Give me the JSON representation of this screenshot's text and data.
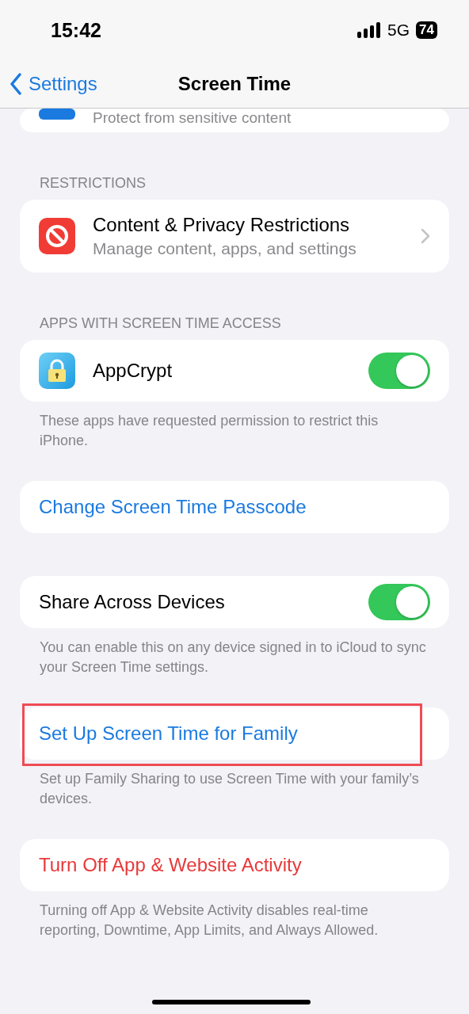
{
  "status_bar": {
    "time": "15:42",
    "network": "5G",
    "battery": "74"
  },
  "nav": {
    "back": "Settings",
    "title": "Screen Time"
  },
  "sections": [
    {
      "rows": [
        {
          "kind": "cut",
          "subtitle": "Protect from sensitive content"
        }
      ]
    },
    {
      "header": "RESTRICTIONS",
      "rows": [
        {
          "kind": "restriction",
          "title": "Content & Privacy Restrictions",
          "subtitle": "Manage content, apps, and settings"
        }
      ]
    },
    {
      "header": "APPS WITH SCREEN TIME ACCESS",
      "rows": [
        {
          "kind": "app",
          "title": "AppCrypt",
          "on": true
        }
      ],
      "footer": "These apps have requested permission to restrict this iPhone."
    },
    {
      "rows": [
        {
          "kind": "link",
          "title": "Change Screen Time Passcode",
          "destructive": false,
          "highlighted": false
        }
      ]
    },
    {
      "rows": [
        {
          "kind": "toggle",
          "title": "Share Across Devices",
          "on": true
        }
      ],
      "footer": "You can enable this on any device signed in to iCloud to sync your Screen Time settings."
    },
    {
      "rows": [
        {
          "kind": "link",
          "title": "Set Up Screen Time for Family",
          "destructive": false,
          "highlighted": true
        }
      ],
      "footer": "Set up Family Sharing to use Screen Time with your family’s devices."
    },
    {
      "rows": [
        {
          "kind": "link",
          "title": "Turn Off App & Website Activity",
          "destructive": true,
          "highlighted": false
        }
      ],
      "footer": "Turning off App & Website Activity disables real-time reporting, Downtime, App Limits, and Always Allowed."
    }
  ]
}
